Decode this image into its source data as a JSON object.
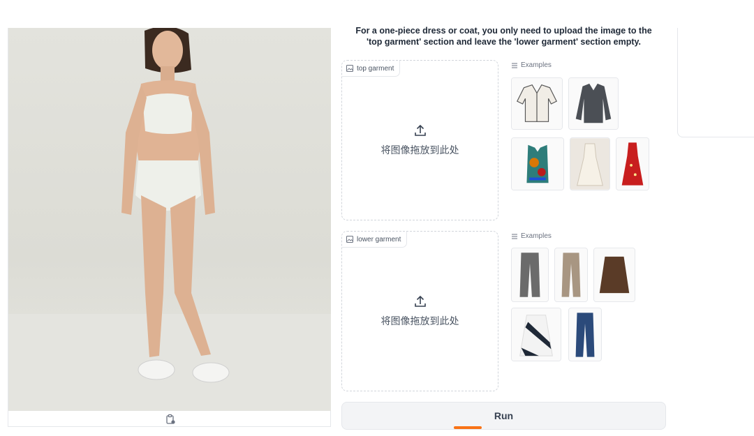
{
  "model_panel": {
    "clipboard_icon": "clipboard-icon"
  },
  "instruction": {
    "line1": "For a one-piece dress or coat, you only need to upload the image to the",
    "line2": "'top garment' section and leave the 'lower garment' section empty."
  },
  "top_garment": {
    "label": "top garment",
    "drop_text": "将图像拖放到此处",
    "examples_label": "Examples"
  },
  "lower_garment": {
    "label": "lower garment",
    "drop_text": "将图像拖放到此处",
    "examples_label": "Examples"
  },
  "run_button": {
    "label": "Run"
  },
  "colors": {
    "accent": "#f97316",
    "border": "#e5e7eb"
  }
}
